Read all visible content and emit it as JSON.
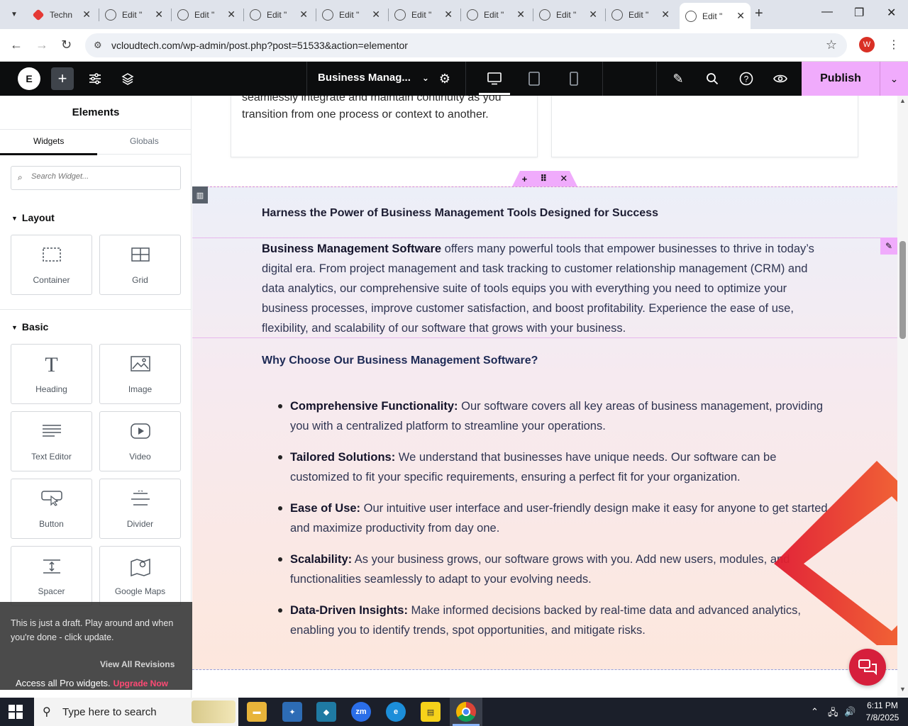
{
  "browser": {
    "tabs": [
      {
        "title": "Techn",
        "icon": "red-diamond-icon"
      },
      {
        "title": "Edit \"",
        "icon": "globe-icon"
      },
      {
        "title": "Edit \"",
        "icon": "globe-icon"
      },
      {
        "title": "Edit \"",
        "icon": "globe-icon"
      },
      {
        "title": "Edit \"",
        "icon": "globe-icon"
      },
      {
        "title": "Edit \"",
        "icon": "globe-icon"
      },
      {
        "title": "Edit \"",
        "icon": "globe-icon"
      },
      {
        "title": "Edit \"",
        "icon": "globe-icon"
      },
      {
        "title": "Edit \"",
        "icon": "globe-icon"
      },
      {
        "title": "Edit \"",
        "icon": "globe-icon",
        "active": true
      }
    ],
    "url": "vcloudtech.com/wp-admin/post.php?post=51533&action=elementor",
    "profile_initial": "W"
  },
  "editor": {
    "document_title": "Business Manag...",
    "publish_label": "Publish",
    "accent": "#f0abfc"
  },
  "panel": {
    "title": "Elements",
    "tabs": [
      "Widgets",
      "Globals"
    ],
    "search_placeholder": "Search Widget...",
    "categories": {
      "layout": "Layout",
      "basic": "Basic"
    },
    "layout_widgets": [
      {
        "label": "Container",
        "icon": "container-icon"
      },
      {
        "label": "Grid",
        "icon": "grid-icon"
      }
    ],
    "basic_widgets": [
      {
        "label": "Heading",
        "icon": "heading-icon"
      },
      {
        "label": "Image",
        "icon": "image-icon"
      },
      {
        "label": "Text Editor",
        "icon": "text-editor-icon"
      },
      {
        "label": "Video",
        "icon": "video-icon"
      },
      {
        "label": "Button",
        "icon": "button-icon"
      },
      {
        "label": "Divider",
        "icon": "divider-icon"
      },
      {
        "label": "Spacer",
        "icon": "spacer-icon"
      },
      {
        "label": "Google Maps",
        "icon": "google-maps-icon"
      }
    ],
    "toast": {
      "message": "This is just a draft. Play around and when you're done - click update.",
      "revisions_link": "View All Revisions"
    },
    "pro_text": "Access all Pro widgets.",
    "pro_link": "Upgrade Now"
  },
  "canvas": {
    "card_text": "seamlessly integrate and maintain continuity as you transition from one process or context to another.",
    "heading": "Harness the Power of Business Management Tools Designed for Success",
    "intro_bold": "Business Management Software",
    "intro_text": " offers many powerful tools that empower businesses to thrive in today’s digital era. From project management and task tracking to customer relationship management (CRM) and data analytics, our comprehensive suite of tools equips you with everything you need to optimize your business processes, improve customer satisfaction, and boost profitability. Experience the ease of use, flexibility, and scalability of our software that grows with your business.",
    "why_heading": "Why Choose Our Business Management Software?",
    "bullets": [
      {
        "bold": "Comprehensive Functionality:",
        "text": " Our software covers all key areas of business management, providing you with a centralized platform to streamline your operations."
      },
      {
        "bold": "Tailored Solutions:",
        "text": " We understand that businesses have unique needs. Our software can be customized to fit your specific requirements, ensuring a perfect fit for your organization."
      },
      {
        "bold": "Ease of Use:",
        "text": " Our intuitive user interface and user-friendly design make it easy for anyone to get started and maximize productivity from day one."
      },
      {
        "bold": "Scalability:",
        "text": " As your business grows, our software grows with you. Add new users, modules, and functionalities seamlessly to adapt to your evolving needs."
      },
      {
        "bold": "Data-Driven Insights:",
        "text": " Make informed decisions backed by real-time data and advanced analytics, enabling you to identify trends, spot opportunities, and mitigate risks."
      }
    ]
  },
  "taskbar": {
    "search_placeholder": "Type here to search",
    "time": "6:11 PM",
    "date": "7/8/2025"
  }
}
